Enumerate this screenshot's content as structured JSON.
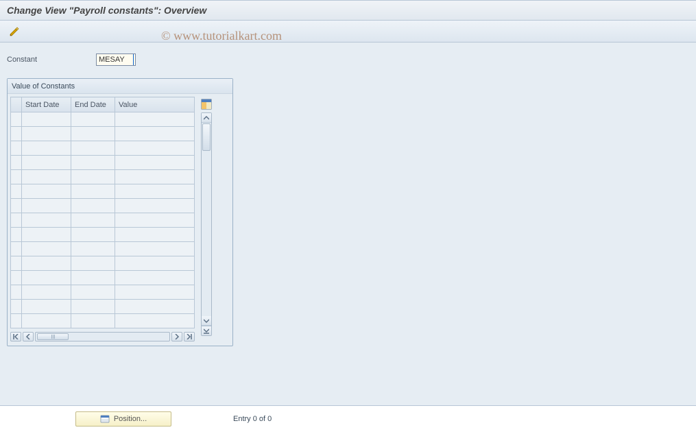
{
  "header": {
    "title": "Change View \"Payroll constants\": Overview"
  },
  "toolbar": {
    "edit_tooltip": "Change"
  },
  "form": {
    "constant_label": "Constant",
    "constant_value": "MESAY"
  },
  "group": {
    "title": "Value of Constants",
    "columns": {
      "start": "Start Date",
      "end": "End Date",
      "value": "Value"
    },
    "rows": [
      {
        "start": "",
        "end": "",
        "value": ""
      },
      {
        "start": "",
        "end": "",
        "value": ""
      },
      {
        "start": "",
        "end": "",
        "value": ""
      },
      {
        "start": "",
        "end": "",
        "value": ""
      },
      {
        "start": "",
        "end": "",
        "value": ""
      },
      {
        "start": "",
        "end": "",
        "value": ""
      },
      {
        "start": "",
        "end": "",
        "value": ""
      },
      {
        "start": "",
        "end": "",
        "value": ""
      },
      {
        "start": "",
        "end": "",
        "value": ""
      },
      {
        "start": "",
        "end": "",
        "value": ""
      },
      {
        "start": "",
        "end": "",
        "value": ""
      },
      {
        "start": "",
        "end": "",
        "value": ""
      },
      {
        "start": "",
        "end": "",
        "value": ""
      },
      {
        "start": "",
        "end": "",
        "value": ""
      },
      {
        "start": "",
        "end": "",
        "value": ""
      }
    ]
  },
  "footer": {
    "position_label": "Position...",
    "entry_text": "Entry 0 of 0"
  },
  "watermark": "© www.tutorialkart.com"
}
